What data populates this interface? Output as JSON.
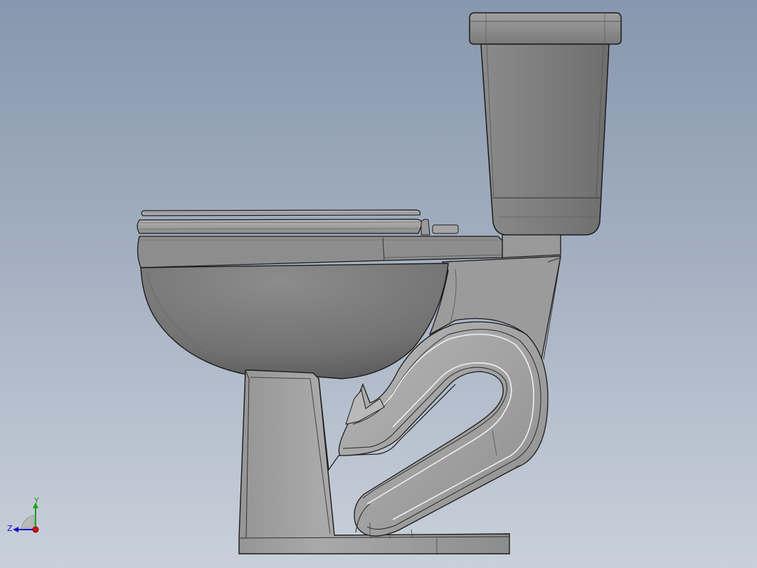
{
  "view": {
    "background_top": "#8797ad",
    "background_bottom": "#c9d0da",
    "model_face_color": "#8f8f8f",
    "model_edge_color": "#1c1c1c"
  },
  "triad": {
    "x_label": "",
    "y_label": "Y",
    "z_label": "Z",
    "x_color": "#d01010",
    "y_color": "#1aa01a",
    "z_color": "#1414c8"
  }
}
